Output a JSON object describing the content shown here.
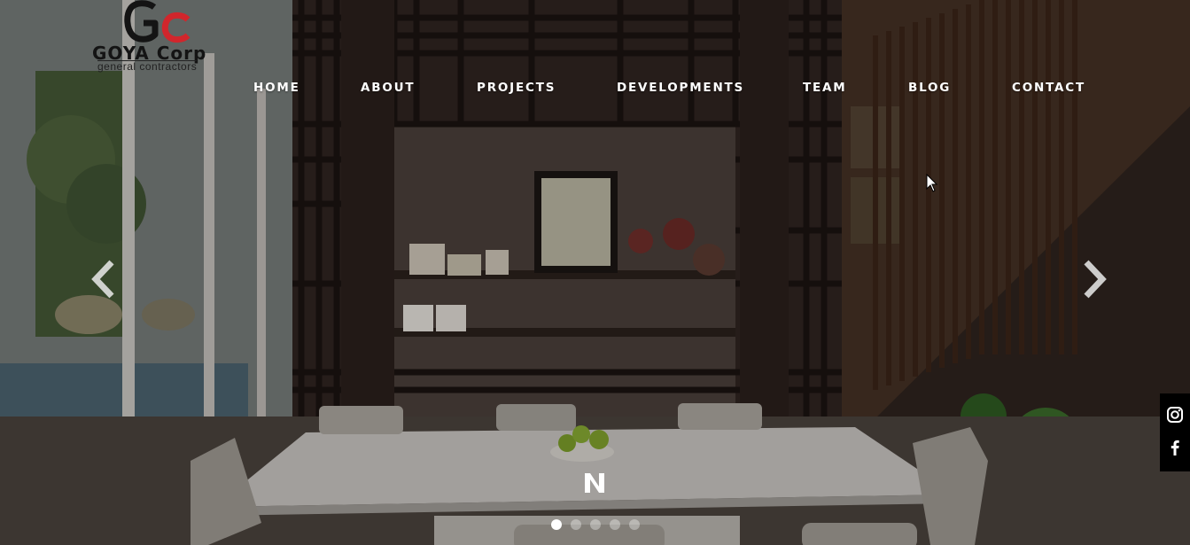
{
  "brand": {
    "name": "GOYA Corp",
    "tagline": "general contractors",
    "colors": {
      "dark": "#141414",
      "accent": "#d1262c"
    }
  },
  "nav": {
    "items": [
      {
        "label": "HOME"
      },
      {
        "label": "ABOUT"
      },
      {
        "label": "PROJECTS"
      },
      {
        "label": "DEVELOPMENTS"
      },
      {
        "label": "TEAM"
      },
      {
        "label": "BLOG"
      },
      {
        "label": "CONTACT"
      }
    ]
  },
  "slider": {
    "prev_icon": "chevron-left-icon",
    "next_icon": "chevron-right-icon",
    "slide_count": 5,
    "active_slide": 1
  },
  "badge": {
    "icon": "n-logo-icon"
  },
  "social": [
    {
      "icon": "instagram-icon"
    },
    {
      "icon": "facebook-icon"
    }
  ]
}
